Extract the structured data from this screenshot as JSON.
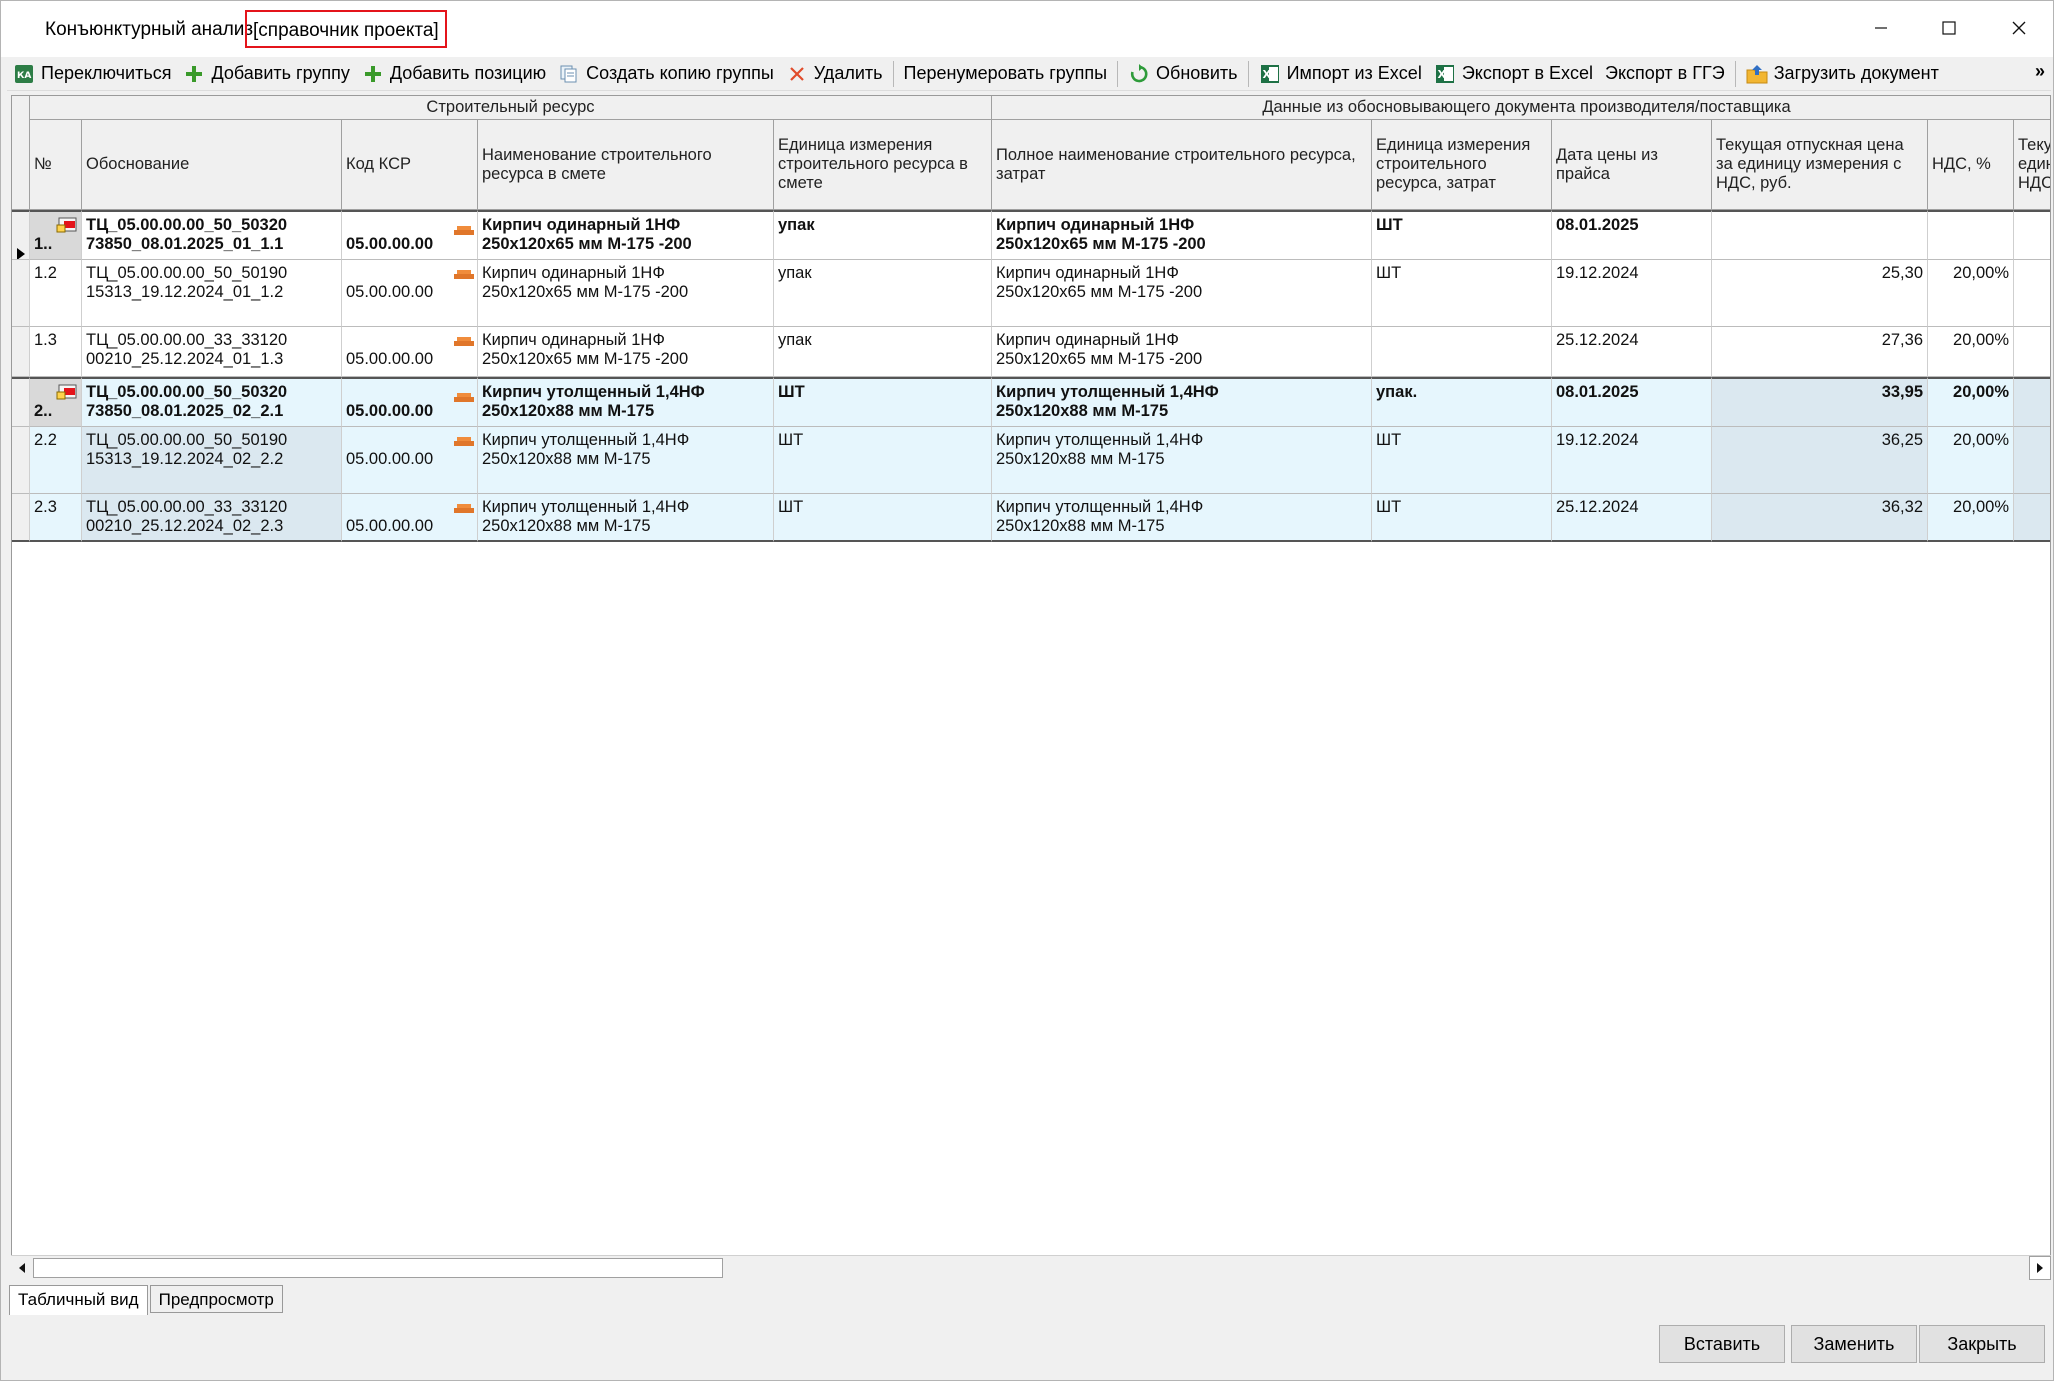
{
  "window": {
    "title": "Конъюнктурный анализ",
    "title_hint": "[справочник проекта]"
  },
  "toolbar": {
    "switch": "Переключиться",
    "add_group": "Добавить группу",
    "add_position": "Добавить позицию",
    "copy_group": "Создать копию группы",
    "delete": "Удалить",
    "renumber": "Перенумеровать группы",
    "refresh": "Обновить",
    "import_excel": "Импорт из Excel",
    "export_excel": "Экспорт в Excel",
    "export_gge": "Экспорт в ГГЭ",
    "load_doc": "Загрузить документ",
    "more": "»"
  },
  "bands": {
    "resource": "Строительный ресурс",
    "supplier": "Данные из обосновывающего документа производителя/поставщика"
  },
  "columns": {
    "num": "№",
    "basis": "Обоснование",
    "ksr": "Код КСР",
    "name": "Наименование строительного ресурса в смете",
    "unit": "Единица измерения строительного ресурса в смете",
    "fullname": "Полное наименование строительного ресурса, затрат",
    "unit2": "Единица измерения строительного ресурса, затрат",
    "date": "Дата цены из прайса",
    "price": "Текущая отпускная цена за единицу измерения с НДС, руб.",
    "vat": "НДС, %",
    "next": "Теку единица НДС,"
  },
  "rows": [
    {
      "num": "1..",
      "basis": "ТЦ_05.00.00.00_50_50320\n73850_08.01.2025_01_1.1",
      "ksr": "05.00.00.00",
      "name": "Кирпич одинарный 1НФ\n250х120х65 мм М-175 -200",
      "unit": "упак",
      "fullname": "Кирпич одинарный 1НФ\n250х120х65 мм М-175 -200",
      "unit2": "ШТ",
      "date": "08.01.2025",
      "price": "",
      "vat": ""
    },
    {
      "num": "1.2",
      "basis": "ТЦ_05.00.00.00_50_50190\n15313_19.12.2024_01_1.2",
      "ksr": "05.00.00.00",
      "name": "Кирпич одинарный 1НФ\n250х120х65 мм М-175 -200",
      "unit": "упак",
      "fullname": "Кирпич одинарный 1НФ\n250х120х65 мм М-175 -200",
      "unit2": "ШТ",
      "date": "19.12.2024",
      "price": "25,30",
      "vat": "20,00%"
    },
    {
      "num": "1.3",
      "basis": "ТЦ_05.00.00.00_33_33120\n00210_25.12.2024_01_1.3",
      "ksr": "05.00.00.00",
      "name": "Кирпич одинарный 1НФ\n250х120х65 мм М-175 -200",
      "unit": "упак",
      "fullname": "Кирпич одинарный 1НФ\n250х120х65 мм М-175 -200",
      "unit2": "",
      "date": "25.12.2024",
      "price": "27,36",
      "vat": "20,00%"
    },
    {
      "num": "2..",
      "basis": "ТЦ_05.00.00.00_50_50320\n73850_08.01.2025_02_2.1",
      "ksr": "05.00.00.00",
      "name": "Кирпич утолщенный 1,4НФ\n250х120х88 мм М-175",
      "unit": "ШТ",
      "fullname": "Кирпич утолщенный 1,4НФ\n250х120х88 мм М-175",
      "unit2": "упак.",
      "date": "08.01.2025",
      "price": "33,95",
      "vat": "20,00%"
    },
    {
      "num": "2.2",
      "basis": "ТЦ_05.00.00.00_50_50190\n15313_19.12.2024_02_2.2",
      "ksr": "05.00.00.00",
      "name": "Кирпич утолщенный 1,4НФ\n250х120х88 мм М-175",
      "unit": "ШТ",
      "fullname": "Кирпич утолщенный 1,4НФ\n250х120х88 мм М-175",
      "unit2": "ШТ",
      "date": "19.12.2024",
      "price": "36,25",
      "vat": "20,00%"
    },
    {
      "num": "2.3",
      "basis": "ТЦ_05.00.00.00_33_33120\n00210_25.12.2024_02_2.3",
      "ksr": "05.00.00.00",
      "name": "Кирпич утолщенный 1,4НФ\n250х120х88 мм М-175",
      "unit": "ШТ",
      "fullname": "Кирпич утолщенный 1,4НФ\n250х120х88 мм М-175",
      "unit2": "ШТ",
      "date": "25.12.2024",
      "price": "36,32",
      "vat": "20,00%"
    }
  ],
  "tabs": {
    "table": "Табличный вид",
    "preview": "Предпросмотр"
  },
  "buttons": {
    "insert": "Вставить",
    "replace": "Заменить",
    "close": "Закрыть"
  },
  "colors": {
    "accent_red": "#e4141b",
    "group_blue": "#e6f6fd",
    "add_green": "#3a9a2a"
  }
}
